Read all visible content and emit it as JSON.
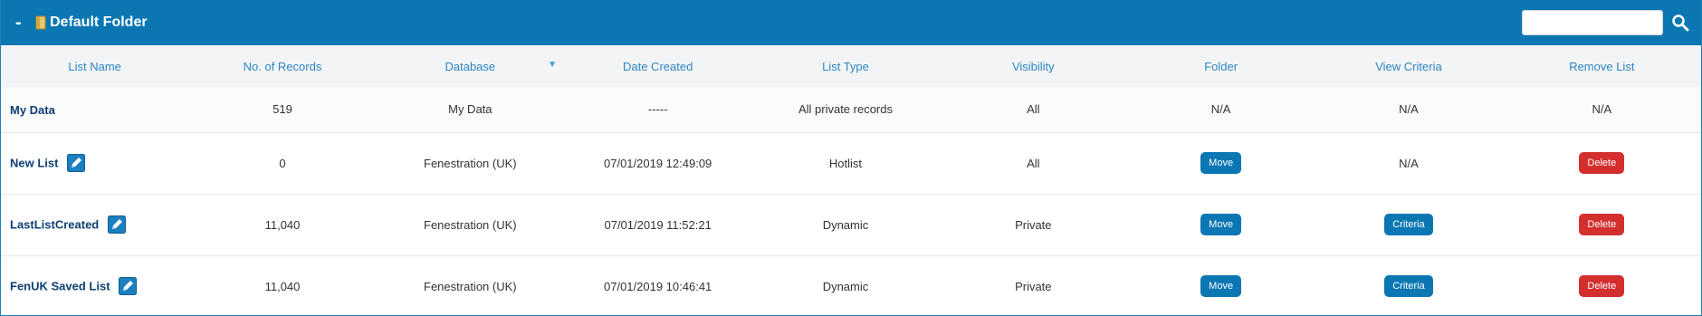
{
  "folder": {
    "collapse_glyph": "-",
    "icon": "folder-icon",
    "title": "Default Folder",
    "search_value": "",
    "search_icon": "search-icon"
  },
  "table": {
    "headers": [
      "List Name",
      "No. of Records",
      "Database",
      "Date Created",
      "List Type",
      "Visibility",
      "Folder",
      "View Criteria",
      "Remove List"
    ],
    "sort_indicator": "▼",
    "rows": [
      {
        "name": "My Data",
        "records": "519",
        "database": "My Data",
        "date": "-----",
        "type": "All private records",
        "visibility": "All",
        "folder": "N/A",
        "criteria": "N/A",
        "remove": "N/A"
      },
      {
        "name": "New List",
        "records": "0",
        "database": "Fenestration (UK)",
        "date": "07/01/2019 12:49:09",
        "type": "Hotlist",
        "visibility": "All",
        "folder": "Move",
        "criteria": "N/A",
        "remove": "Delete"
      },
      {
        "name": "LastListCreated",
        "records": "11,040",
        "database": "Fenestration (UK)",
        "date": "07/01/2019 11:52:21",
        "type": "Dynamic",
        "visibility": "Private",
        "folder": "Move",
        "criteria": "Criteria",
        "remove": "Delete"
      },
      {
        "name": "FenUK Saved List",
        "records": "11,040",
        "database": "Fenestration (UK)",
        "date": "07/01/2019 10:46:41",
        "type": "Dynamic",
        "visibility": "Private",
        "folder": "Move",
        "criteria": "Criteria",
        "remove": "Delete"
      }
    ]
  },
  "colors": {
    "header_bg": "#0a77b3",
    "link": "#0e3e73",
    "column_header": "#2d86c2",
    "delete_btn": "#d42f2f",
    "move_btn": "#0a77b3"
  }
}
